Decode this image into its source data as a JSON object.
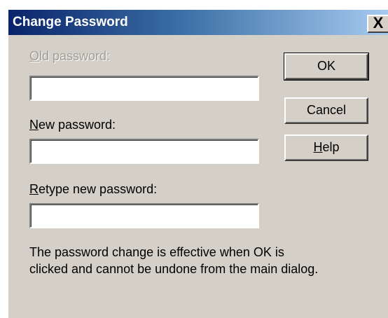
{
  "dialog": {
    "title": "Change Password",
    "close_label": "X"
  },
  "form": {
    "old_password": {
      "label_accel": "O",
      "label_rest": "ld password:",
      "value": "",
      "enabled": false
    },
    "new_password": {
      "label_accel": "N",
      "label_rest": "ew password:",
      "value": ""
    },
    "retype_password": {
      "label_accel": "R",
      "label_rest": "etype new password:",
      "value": ""
    }
  },
  "buttons": {
    "ok_label": "OK",
    "cancel_label": "Cancel",
    "help_accel": "H",
    "help_rest": "elp"
  },
  "info": {
    "line1": "The password change is effective when OK is",
    "line2": "clicked and cannot be undone from the main dialog."
  },
  "colors": {
    "titlebar_start": "#0a246a",
    "titlebar_end": "#a6caf0",
    "face": "#d4d0c8",
    "disabled_text": "#a09d96"
  }
}
